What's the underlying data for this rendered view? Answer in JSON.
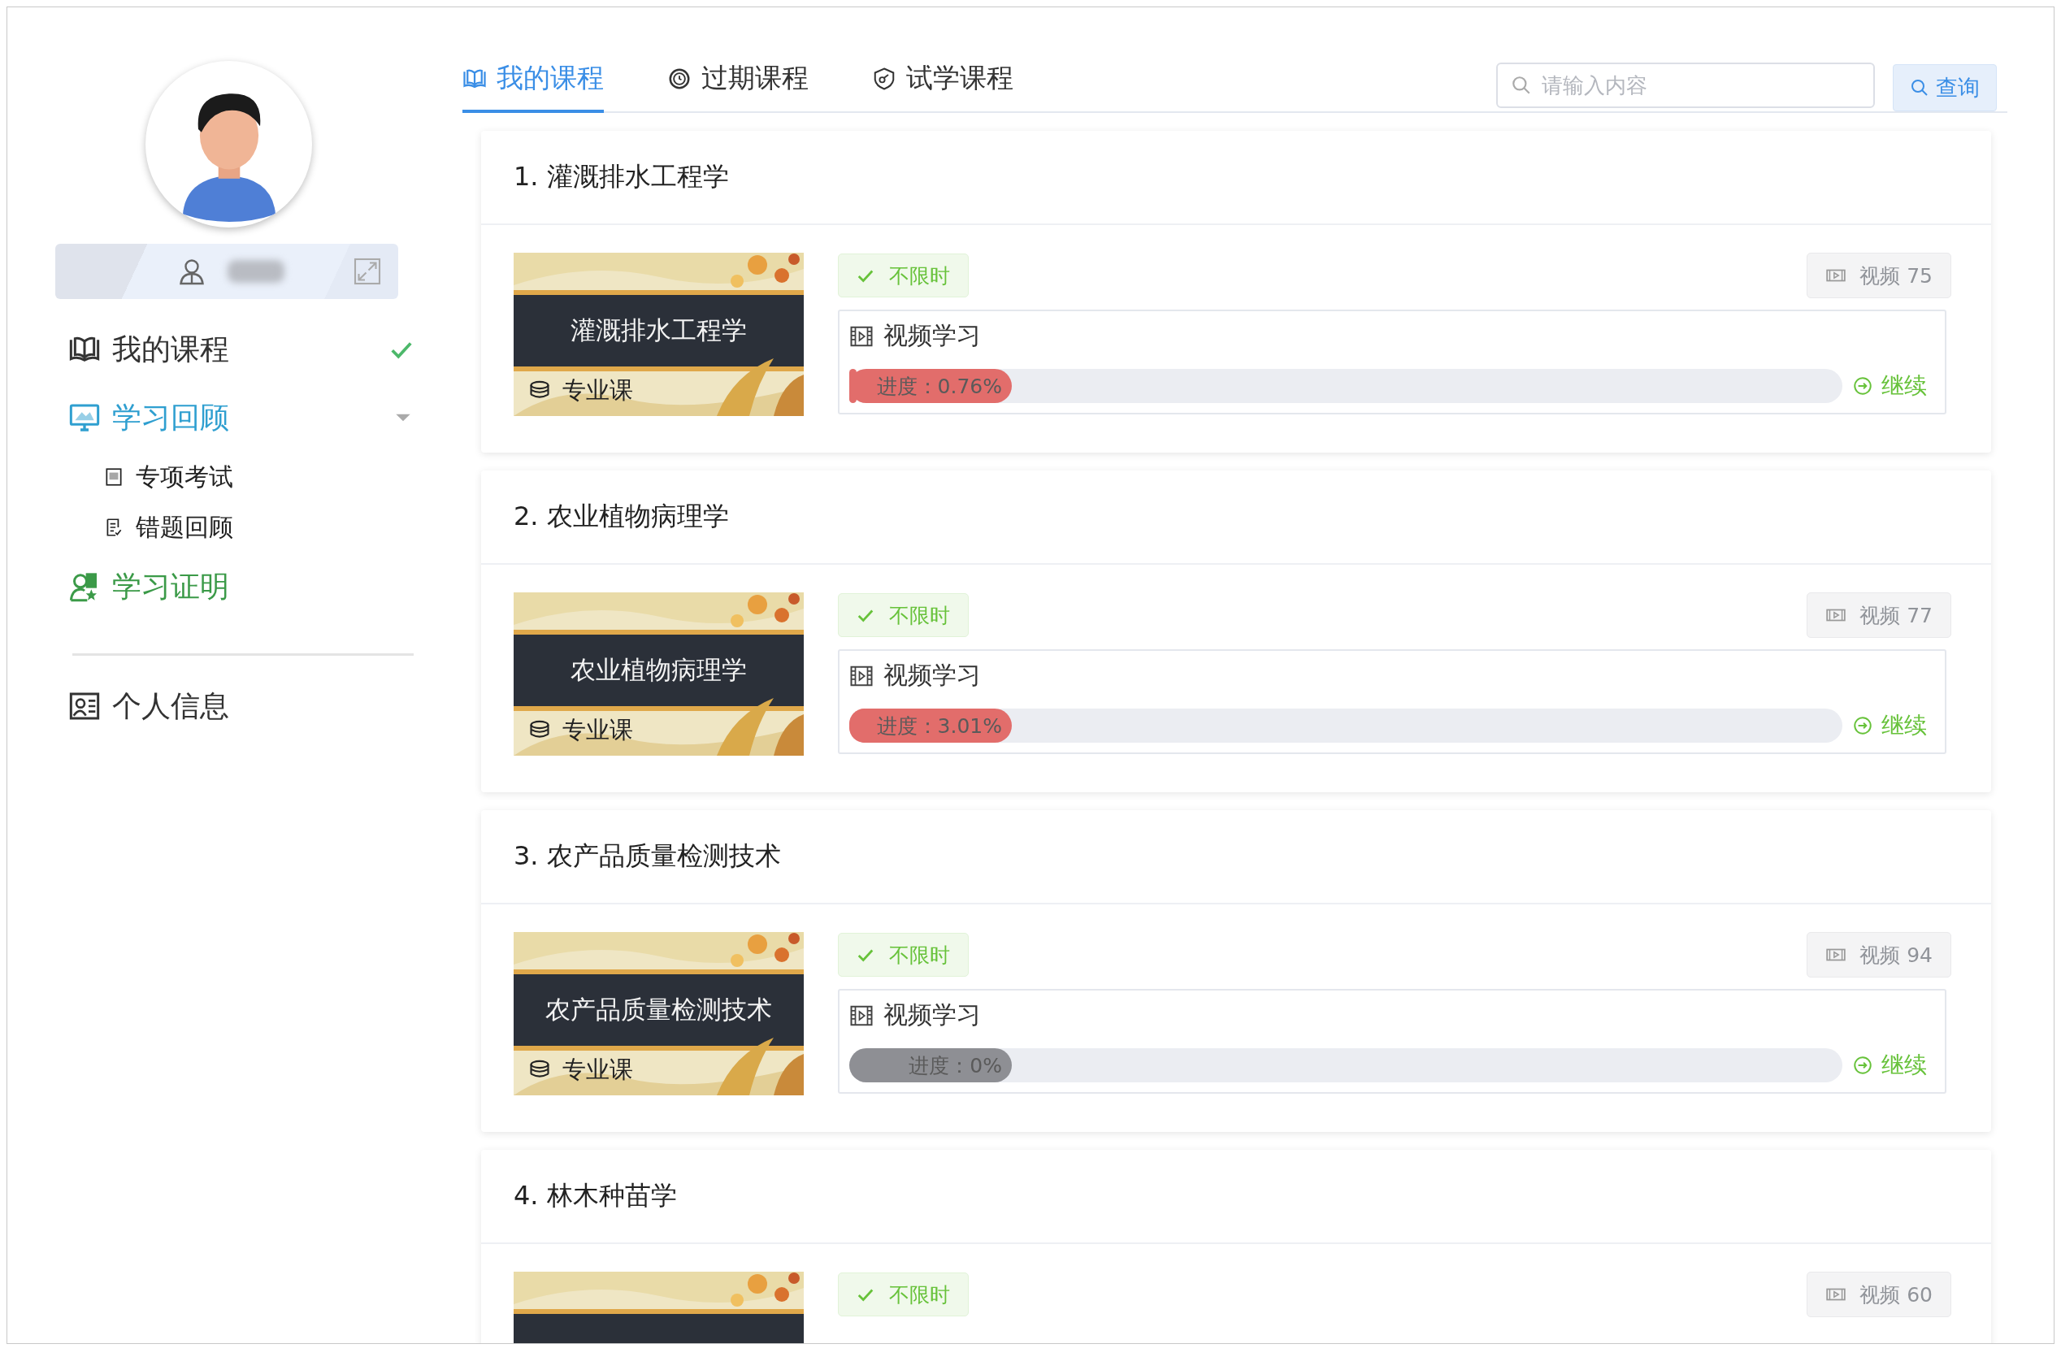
{
  "sidebar": {
    "items": [
      {
        "label": "我的课程",
        "checked": true,
        "color": "#333333"
      },
      {
        "label": "学习回顾",
        "checked": false,
        "expanded": true,
        "color": "#2f9fd0",
        "children": [
          {
            "label": "专项考试"
          },
          {
            "label": "错题回顾"
          }
        ]
      },
      {
        "label": "学习证明",
        "checked": false,
        "color": "#3b9a48"
      }
    ],
    "footer_items": [
      {
        "label": "个人信息"
      }
    ]
  },
  "tabs": [
    {
      "label": "我的课程",
      "selected": true
    },
    {
      "label": "过期课程",
      "selected": false
    },
    {
      "label": "试学课程",
      "selected": false
    }
  ],
  "search": {
    "placeholder": "请输入内容",
    "button": "查询"
  },
  "courses": [
    {
      "title": "1. 灌溉排水工程学",
      "cover_title": "灌溉排水工程学",
      "cover_tag": "专业课",
      "time_tag": "不限时",
      "video_count": "视频 75",
      "section": "视频学习",
      "progress_label": "进度：0.76%",
      "level": 0.0076,
      "action": "继续"
    },
    {
      "title": "2. 农业植物病理学",
      "cover_title": "农业植物病理学",
      "cover_tag": "专业课",
      "time_tag": "不限时",
      "video_count": "视频 77",
      "section": "视频学习",
      "progress_label": "进度：3.01%",
      "level": 0.0301,
      "action": "继续"
    },
    {
      "title": "3. 农产品质量检测技术",
      "cover_title": "农产品质量检测技术",
      "cover_tag": "专业课",
      "time_tag": "不限时",
      "video_count": "视频 94",
      "section": "视频学习",
      "progress_label": "进度：0%",
      "level": 0,
      "action": "继续"
    },
    {
      "title": "4. 林木种苗学",
      "time_tag": "不限时",
      "video_count": "视频 60"
    }
  ]
}
